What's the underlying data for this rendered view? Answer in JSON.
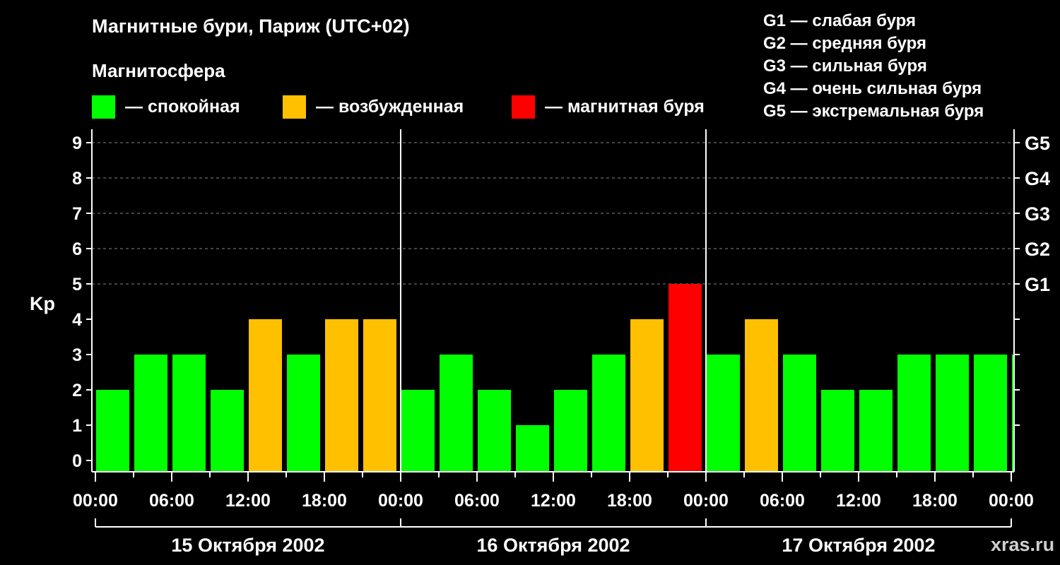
{
  "title": "Магнитные бури, Париж (UTC+02)",
  "subtitle": "Магнитосфера",
  "legend": [
    {
      "label": "— спокойная",
      "color": "#00ff00"
    },
    {
      "label": "— возбужденная",
      "color": "#ffc000"
    },
    {
      "label": "— магнитная буря",
      "color": "#ff0000"
    }
  ],
  "storm_scale": [
    "G1 — слабая буря",
    "G2 — средняя буря",
    "G3 — сильная буря",
    "G4 — очень сильная буря",
    "G5 — экстремальная буря"
  ],
  "watermark": "xras.ru",
  "chart_data": {
    "type": "bar",
    "title": "Магнитные бури, Париж (UTC+02)",
    "ylabel": "Kp",
    "ylim": [
      0,
      9
    ],
    "yticks": [
      "0",
      "1",
      "2",
      "3",
      "4",
      "5",
      "6",
      "7",
      "8",
      "9"
    ],
    "right_ticks": [
      {
        "value": 5,
        "label": "G1"
      },
      {
        "value": 6,
        "label": "G2"
      },
      {
        "value": 7,
        "label": "G3"
      },
      {
        "value": 8,
        "label": "G4"
      },
      {
        "value": 9,
        "label": "G5"
      }
    ],
    "xticks": [
      "00:00",
      "06:00",
      "12:00",
      "18:00",
      "00:00",
      "06:00",
      "12:00",
      "18:00",
      "00:00",
      "06:00",
      "12:00",
      "18:00",
      "00:00"
    ],
    "days": [
      "15 Октября 2002",
      "16 Октября 2002",
      "17 Октября 2002"
    ],
    "grid": true,
    "values": [
      2,
      3,
      3,
      2,
      4,
      3,
      4,
      4,
      2,
      3,
      2,
      1,
      2,
      3,
      4,
      5,
      3,
      4,
      3,
      2,
      2,
      3,
      3,
      3,
      3
    ],
    "levels": [
      "quiet",
      "quiet",
      "quiet",
      "quiet",
      "active",
      "quiet",
      "active",
      "active",
      "quiet",
      "quiet",
      "quiet",
      "quiet",
      "quiet",
      "quiet",
      "active",
      "storm",
      "quiet",
      "active",
      "quiet",
      "quiet",
      "quiet",
      "quiet",
      "quiet",
      "quiet",
      "quiet"
    ],
    "colors": {
      "quiet": "#00ff00",
      "active": "#ffc000",
      "storm": "#ff0000"
    }
  }
}
